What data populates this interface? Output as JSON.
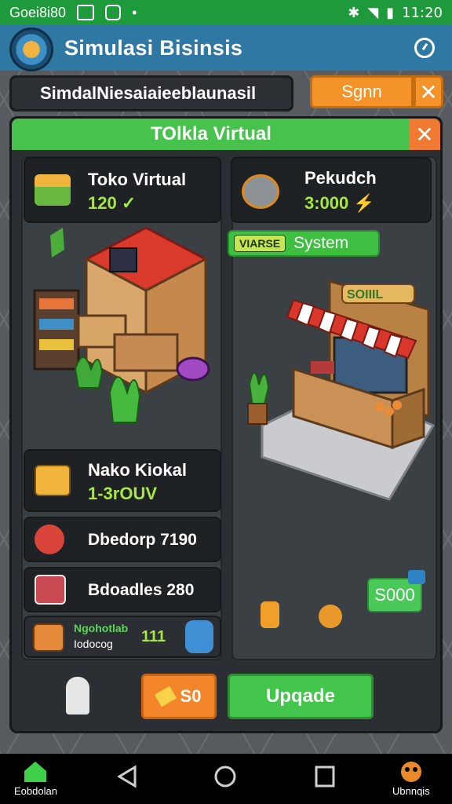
{
  "status_bar": {
    "left_text": "Goei8i80",
    "time": "11:20"
  },
  "app_bar": {
    "title": "Simulasi Bisinsis"
  },
  "top_bar": {
    "text": "SimdalNiesaiaieeblaunasil",
    "sign_label": "Sgnn",
    "close_label": "✕"
  },
  "panel": {
    "title": "TOlkla Virtual",
    "close_label": "✕",
    "left_cards": [
      {
        "title": "Toko Virtual",
        "value": "120 ✓"
      },
      {
        "title": "Nako Kiokal",
        "value": "1-3rOUV"
      },
      {
        "title": "Dbedorp 7190",
        "value": ""
      },
      {
        "title": "Bdoadles 280",
        "value": ""
      }
    ],
    "stat_card": {
      "line1": "Ngohotlab",
      "line2": "Iodocog",
      "value": "111"
    },
    "right_card": {
      "title": "Pekudch",
      "value": "3:000 ⚡"
    },
    "system_badge": {
      "tag": "VIARSE",
      "label": "System"
    },
    "stall_sign": "SOIIIL",
    "price_label": "S000"
  },
  "actions": {
    "orange_label": "S0",
    "green_label": "Upqade"
  },
  "nav_bar": {
    "home_label": "Eobdolan",
    "profile_label": "Ubnnqis"
  },
  "colors": {
    "green": "#47c24d",
    "orange": "#f3862a",
    "appbar": "#2f78a4",
    "value_green": "#a6e83d"
  }
}
